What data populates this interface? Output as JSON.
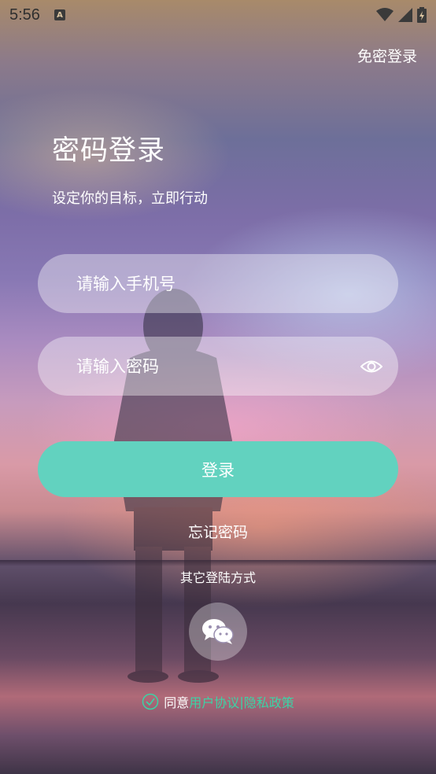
{
  "status_bar": {
    "time": "5:56",
    "notification_icon": "a-icon",
    "wifi_icon": "wifi-icon",
    "signal_icon": "signal-icon",
    "battery_icon": "battery-charging-icon"
  },
  "header": {
    "passwordless_login_label": "免密登录"
  },
  "main": {
    "title": "密码登录",
    "subtitle": "设定你的目标，立即行动",
    "phone_input": {
      "value": "",
      "placeholder": "请输入手机号"
    },
    "password_input": {
      "value": "",
      "placeholder": "请输入密码",
      "toggle_icon": "eye-icon"
    },
    "login_button_label": "登录",
    "forgot_password_label": "忘记密码",
    "other_login_title": "其它登陆方式",
    "wechat_icon": "wechat-icon"
  },
  "agreement": {
    "checkbox_icon": "check-circle-icon",
    "prefix": "同意",
    "user_agreement": "用户协议",
    "separator": "|",
    "privacy_policy": "隐私政策"
  },
  "colors": {
    "accent": "#62d2bf",
    "link_green": "#3ad4a6",
    "input_bg": "rgba(255,255,255,0.38)"
  }
}
